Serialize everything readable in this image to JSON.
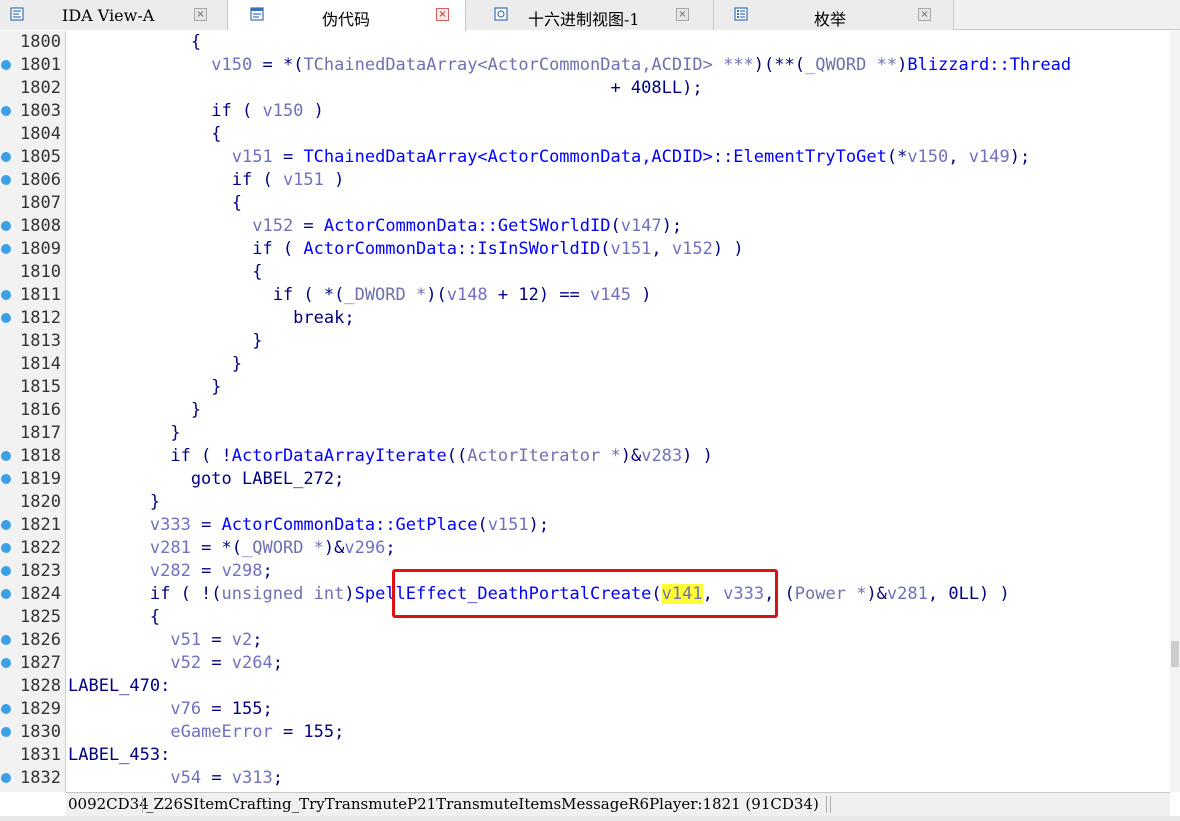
{
  "tabs": [
    {
      "label": "IDA View-A",
      "icon": "ida-view-icon",
      "active": false
    },
    {
      "label": "伪代码",
      "icon": "pseudocode-icon",
      "active": true
    },
    {
      "label": "十六进制视图-1",
      "icon": "hex-view-icon",
      "active": false
    },
    {
      "label": "枚举",
      "icon": "enums-icon",
      "active": false
    }
  ],
  "code_lines": [
    {
      "no": "1800",
      "dot": false,
      "segs": [
        [
          "p",
          "            {"
        ]
      ]
    },
    {
      "no": "1801",
      "dot": true,
      "segs": [
        [
          "p",
          "              "
        ],
        [
          "v",
          "v150"
        ],
        [
          "p",
          " = *("
        ],
        [
          "t",
          "TChainedDataArray<ActorCommonData,ACDID> ***"
        ],
        [
          "p",
          ")(**("
        ],
        [
          "t",
          "_QWORD **"
        ],
        [
          "p",
          ")"
        ],
        [
          "f",
          "Blizzard::Thread"
        ]
      ]
    },
    {
      "no": "1802",
      "dot": false,
      "segs": [
        [
          "p",
          "                                                     + 408LL);"
        ]
      ]
    },
    {
      "no": "1803",
      "dot": true,
      "segs": [
        [
          "p",
          "              if ( "
        ],
        [
          "v",
          "v150"
        ],
        [
          "p",
          " )"
        ]
      ]
    },
    {
      "no": "1804",
      "dot": false,
      "segs": [
        [
          "p",
          "              {"
        ]
      ]
    },
    {
      "no": "1805",
      "dot": true,
      "segs": [
        [
          "p",
          "                "
        ],
        [
          "v",
          "v151"
        ],
        [
          "p",
          " = "
        ],
        [
          "f",
          "TChainedDataArray<ActorCommonData,ACDID>::ElementTryToGet"
        ],
        [
          "p",
          "(*"
        ],
        [
          "v",
          "v150"
        ],
        [
          "p",
          ", "
        ],
        [
          "v",
          "v149"
        ],
        [
          "p",
          ");"
        ]
      ]
    },
    {
      "no": "1806",
      "dot": true,
      "segs": [
        [
          "p",
          "                if ( "
        ],
        [
          "v",
          "v151"
        ],
        [
          "p",
          " )"
        ]
      ]
    },
    {
      "no": "1807",
      "dot": false,
      "segs": [
        [
          "p",
          "                {"
        ]
      ]
    },
    {
      "no": "1808",
      "dot": true,
      "segs": [
        [
          "p",
          "                  "
        ],
        [
          "v",
          "v152"
        ],
        [
          "p",
          " = "
        ],
        [
          "f",
          "ActorCommonData::GetSWorldID"
        ],
        [
          "p",
          "("
        ],
        [
          "v",
          "v147"
        ],
        [
          "p",
          ");"
        ]
      ]
    },
    {
      "no": "1809",
      "dot": true,
      "segs": [
        [
          "p",
          "                  if ( "
        ],
        [
          "f",
          "ActorCommonData::IsInSWorldID"
        ],
        [
          "p",
          "("
        ],
        [
          "v",
          "v151"
        ],
        [
          "p",
          ", "
        ],
        [
          "v",
          "v152"
        ],
        [
          "p",
          ") )"
        ]
      ]
    },
    {
      "no": "1810",
      "dot": false,
      "segs": [
        [
          "p",
          "                  {"
        ]
      ]
    },
    {
      "no": "1811",
      "dot": true,
      "segs": [
        [
          "p",
          "                    if ( *("
        ],
        [
          "t",
          "_DWORD *"
        ],
        [
          "p",
          ")("
        ],
        [
          "v",
          "v148"
        ],
        [
          "p",
          " + 12) == "
        ],
        [
          "v",
          "v145"
        ],
        [
          "p",
          " )"
        ]
      ]
    },
    {
      "no": "1812",
      "dot": true,
      "segs": [
        [
          "p",
          "                      break;"
        ]
      ]
    },
    {
      "no": "1813",
      "dot": false,
      "segs": [
        [
          "p",
          "                  }"
        ]
      ]
    },
    {
      "no": "1814",
      "dot": false,
      "segs": [
        [
          "p",
          "                }"
        ]
      ]
    },
    {
      "no": "1815",
      "dot": false,
      "segs": [
        [
          "p",
          "              }"
        ]
      ]
    },
    {
      "no": "1816",
      "dot": false,
      "segs": [
        [
          "p",
          "            }"
        ]
      ]
    },
    {
      "no": "1817",
      "dot": false,
      "segs": [
        [
          "p",
          "          }"
        ]
      ]
    },
    {
      "no": "1818",
      "dot": true,
      "segs": [
        [
          "p",
          "          if ( !"
        ],
        [
          "f",
          "ActorDataArrayIterate"
        ],
        [
          "p",
          "(("
        ],
        [
          "t",
          "ActorIterator *"
        ],
        [
          "p",
          ")&"
        ],
        [
          "v",
          "v283"
        ],
        [
          "p",
          ") )"
        ]
      ]
    },
    {
      "no": "1819",
      "dot": true,
      "segs": [
        [
          "p",
          "            goto LABEL_272;"
        ]
      ]
    },
    {
      "no": "1820",
      "dot": false,
      "segs": [
        [
          "p",
          "        }"
        ]
      ]
    },
    {
      "no": "1821",
      "dot": true,
      "segs": [
        [
          "p",
          "        "
        ],
        [
          "v",
          "v333"
        ],
        [
          "p",
          " = "
        ],
        [
          "f",
          "ActorCommonData::GetPlace"
        ],
        [
          "p",
          "("
        ],
        [
          "v",
          "v151"
        ],
        [
          "p",
          ");"
        ]
      ]
    },
    {
      "no": "1822",
      "dot": true,
      "segs": [
        [
          "p",
          "        "
        ],
        [
          "v",
          "v281"
        ],
        [
          "p",
          " = *("
        ],
        [
          "t",
          "_QWORD *"
        ],
        [
          "p",
          ")&"
        ],
        [
          "v",
          "v296"
        ],
        [
          "p",
          ";"
        ]
      ]
    },
    {
      "no": "1823",
      "dot": true,
      "segs": [
        [
          "p",
          "        "
        ],
        [
          "v",
          "v282"
        ],
        [
          "p",
          " = "
        ],
        [
          "v",
          "v298"
        ],
        [
          "p",
          ";"
        ]
      ]
    },
    {
      "no": "1824",
      "dot": true,
      "segs": [
        [
          "p",
          "        if ( !("
        ],
        [
          "t",
          "unsigned int"
        ],
        [
          "p",
          ")"
        ],
        [
          "f",
          "SpellEffect_DeathPortalCreate"
        ],
        [
          "p",
          "("
        ],
        [
          "hl",
          "v141"
        ],
        [
          "p",
          ", "
        ],
        [
          "v",
          "v333"
        ],
        [
          "p",
          ", ("
        ],
        [
          "t",
          "Power *"
        ],
        [
          "p",
          ")&"
        ],
        [
          "v",
          "v281"
        ],
        [
          "p",
          ", 0LL) )"
        ]
      ]
    },
    {
      "no": "1825",
      "dot": false,
      "segs": [
        [
          "p",
          "        {"
        ]
      ]
    },
    {
      "no": "1826",
      "dot": true,
      "segs": [
        [
          "p",
          "          "
        ],
        [
          "v",
          "v51"
        ],
        [
          "p",
          " = "
        ],
        [
          "v",
          "v2"
        ],
        [
          "p",
          ";"
        ]
      ]
    },
    {
      "no": "1827",
      "dot": true,
      "segs": [
        [
          "p",
          "          "
        ],
        [
          "v",
          "v52"
        ],
        [
          "p",
          " = "
        ],
        [
          "v",
          "v264"
        ],
        [
          "p",
          ";"
        ]
      ]
    },
    {
      "no": "1828",
      "dot": false,
      "segs": [
        [
          "p",
          "LABEL_470:"
        ]
      ]
    },
    {
      "no": "1829",
      "dot": true,
      "segs": [
        [
          "p",
          "          "
        ],
        [
          "v",
          "v76"
        ],
        [
          "p",
          " = 155;"
        ]
      ]
    },
    {
      "no": "1830",
      "dot": true,
      "segs": [
        [
          "p",
          "          "
        ],
        [
          "v",
          "eGameError"
        ],
        [
          "p",
          " = 155;"
        ]
      ]
    },
    {
      "no": "1831",
      "dot": false,
      "segs": [
        [
          "p",
          "LABEL_453:"
        ]
      ]
    },
    {
      "no": "1832",
      "dot": true,
      "segs": [
        [
          "p",
          "          "
        ],
        [
          "v",
          "v54"
        ],
        [
          "p",
          " = "
        ],
        [
          "v",
          "v313"
        ],
        [
          "p",
          ";"
        ]
      ]
    }
  ],
  "status": {
    "address": "0092CD34",
    "location": "_Z26SItemCrafting_TryTransmuteP21TransmuteItemsMessageR6Player:1821 (91CD34)"
  },
  "colors": {
    "code_text": "#000080",
    "variable": "#7070c0",
    "type": "#7070b0",
    "function": "#0000ff",
    "highlight": "#ffff33",
    "annotation_box": "#e01010",
    "breakpoint_dot": "#3ba0e6"
  }
}
